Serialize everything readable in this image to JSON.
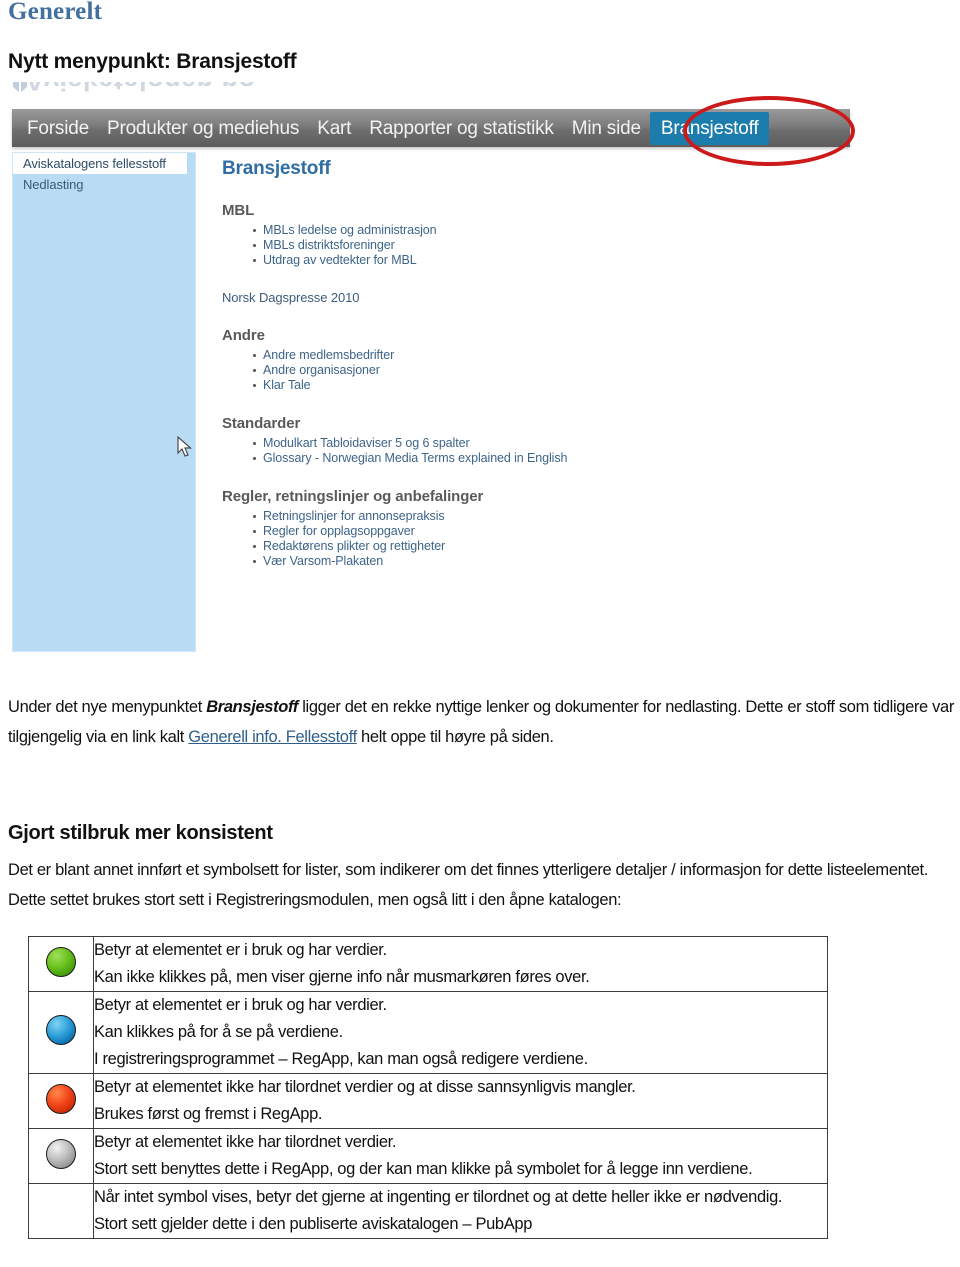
{
  "document": {
    "heading_generelt": "Generelt",
    "heading_nytt_menypunkt": "Nytt menypunkt: Bransjestoff",
    "heading_gjort_stilbruk": "Gjort stilbruk mer konsistent"
  },
  "screenshot": {
    "logo_text": "Aviskatalogen.no",
    "navbar": {
      "items": [
        {
          "label": "Forside",
          "active": false
        },
        {
          "label": "Produkter og mediehus",
          "active": false
        },
        {
          "label": "Kart",
          "active": false
        },
        {
          "label": "Rapporter og statistikk",
          "active": false
        },
        {
          "label": "Min side",
          "active": false
        },
        {
          "label": "Bransjestoff",
          "active": true
        }
      ],
      "active_bg": "#1c7cab",
      "annotation_color": "#cc1a1a"
    },
    "sidebar": {
      "items": [
        {
          "label": "Aviskatalogens fellesstoff",
          "selected": true
        },
        {
          "label": "Nedlasting",
          "selected": false
        }
      ],
      "background": "#b9dcf5"
    },
    "main": {
      "title": "Bransjestoff",
      "groups": [
        {
          "heading": "MBL",
          "style": "bold",
          "links": [
            "MBLs ledelse og administrasjon",
            "MBLs distriktsforeninger",
            "Utdrag av vedtekter for MBL"
          ]
        },
        {
          "heading": "Norsk Dagspresse 2010",
          "style": "plain",
          "links": []
        },
        {
          "heading": "Andre",
          "style": "bold",
          "links": [
            "Andre medlemsbedrifter",
            "Andre organisasjoner",
            "Klar Tale"
          ]
        },
        {
          "heading": "Standarder",
          "style": "bold",
          "links": [
            "Modulkart Tabloidaviser 5 og 6 spalter",
            "Glossary - Norwegian Media Terms explained in English"
          ]
        },
        {
          "heading": "Regler, retningslinjer og anbefalinger",
          "style": "bold",
          "links": [
            "Retningslinjer for annonsepraksis",
            "Regler for opplagsoppgaver",
            "Redaktørens plikter og rettigheter",
            "Vær Varsom-Plakaten"
          ]
        }
      ]
    }
  },
  "paragraphs": {
    "intro_part1": "Under det nye menypunktet ",
    "intro_emph": "Bransjestoff",
    "intro_part2": " ligger det en rekke nyttige lenker og dokumenter for nedlasting. Dette er stoff som tidligere var tilgjengelig via en link kalt ",
    "intro_link": "Generell info. Fellesstoff",
    "intro_part3": " helt oppe til høyre på siden.",
    "symbols_intro": "Det er blant annet innført et symbolsett for lister, som indikerer om det finnes ytterligere detaljer / informasjon for dette listeelementet.  Dette settet brukes stort sett i Registreringsmodulen, men også litt i den åpne katalogen:"
  },
  "symbol_table": {
    "rows": [
      {
        "symbol": "green-circle-icon",
        "color": "#6cc21f",
        "lines": [
          "Betyr at elementet er i bruk og har verdier.",
          "Kan ikke klikkes på, men viser gjerne info når musmarkøren føres over."
        ]
      },
      {
        "symbol": "blue-circle-icon",
        "color": "#2e9fd8",
        "lines": [
          "Betyr at elementet er i bruk og har verdier.",
          "Kan klikkes på for å se på verdiene.",
          "I registreringsprogrammet – RegApp, kan man også redigere verdiene."
        ]
      },
      {
        "symbol": "red-circle-icon",
        "color": "#f2451a",
        "lines": [
          "Betyr at elementet ikke har tilordnet verdier og at disse sannsynligvis mangler.",
          "Brukes først og fremst i RegApp."
        ]
      },
      {
        "symbol": "grey-circle-icon",
        "color": "#bdbdbd",
        "lines": [
          "Betyr at elementet ikke har tilordnet verdier.",
          "Stort sett benyttes dette i RegApp, og der kan man klikke på symbolet for å legge inn verdiene."
        ]
      },
      {
        "symbol": "no-icon",
        "color": "",
        "lines": [
          "Når intet symbol vises, betyr det gjerne at ingenting er tilordnet og at dette heller ikke er nødvendig.",
          "Stort sett gjelder dette i den publiserte aviskatalogen – PubApp"
        ]
      }
    ]
  }
}
